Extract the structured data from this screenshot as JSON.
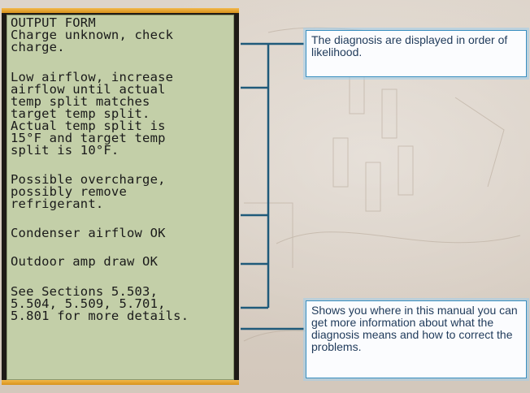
{
  "lcd": {
    "line_1": "OUTPUT FORM",
    "line_2": "Charge unknown, check",
    "line_3": "charge.",
    "line_4": "Low airflow, increase",
    "line_5": "airflow until actual",
    "line_6": "temp split matches",
    "line_7": "target temp split.",
    "line_8": "Actual temp split is",
    "line_9": "15°F and target temp",
    "line_10": "split is 10°F.",
    "line_11": "Possible overcharge,",
    "line_12": "possibly remove",
    "line_13": "refrigerant.",
    "line_14": "Condenser airflow OK",
    "line_15": "Outdoor amp draw OK",
    "line_16": "See Sections 5.503,",
    "line_17": "5.504, 5.509, 5.701,",
    "line_18": "5.801 for more details."
  },
  "callouts": {
    "diagnosis_order": "The diagnosis are displayed in order of likelihood.",
    "manual_sections": "Shows you where in this manual you can get more information about what the diagnosis means and how to correct the problems."
  },
  "colors": {
    "lcd_background": "#c3cfa8",
    "device_trim": "#f2b84a",
    "device_body": "#1e1a16",
    "connector_line": "#1f5a7a",
    "callout_border": "#3a8fc0"
  }
}
